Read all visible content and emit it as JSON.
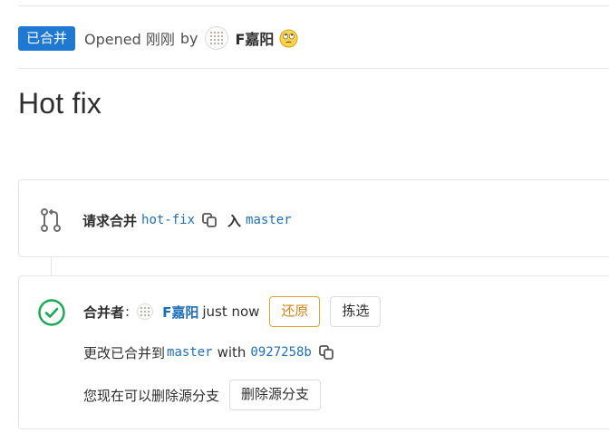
{
  "header": {
    "status_badge": "已合并",
    "opened_text": "Opened 刚刚",
    "by_text": "by",
    "author_name": "F嘉阳",
    "avatar_icon": "identicon-avatar",
    "emoji_icon": "face-with-rolling-eyes-emoji"
  },
  "title": "Hot fix",
  "merge_request": {
    "label": "请求合并",
    "source_branch": "hot-fix",
    "into_label": "入",
    "target_branch": "master",
    "icon": "merge-request-icon",
    "copy_icon": "copy-icon"
  },
  "merged_widget": {
    "status_icon": "check-circle-icon",
    "merged_by_label": "合并者",
    "colon": ":",
    "merger_name": "F嘉阳",
    "merged_time": "just now",
    "revert_label": "还原",
    "cherry_pick_label": "拣选",
    "merged_into_text": "更改已合并到",
    "merged_into_branch": "master",
    "with_text": "with",
    "commit_sha": "0927258b",
    "remove_branch_text": "您现在可以删除源分支",
    "remove_branch_button": "删除源分支"
  },
  "colors": {
    "badge_blue": "#1f78d1",
    "link_blue": "#1f6fb8",
    "success_green": "#1aaa55",
    "revert_orange": "#e0a22e"
  }
}
